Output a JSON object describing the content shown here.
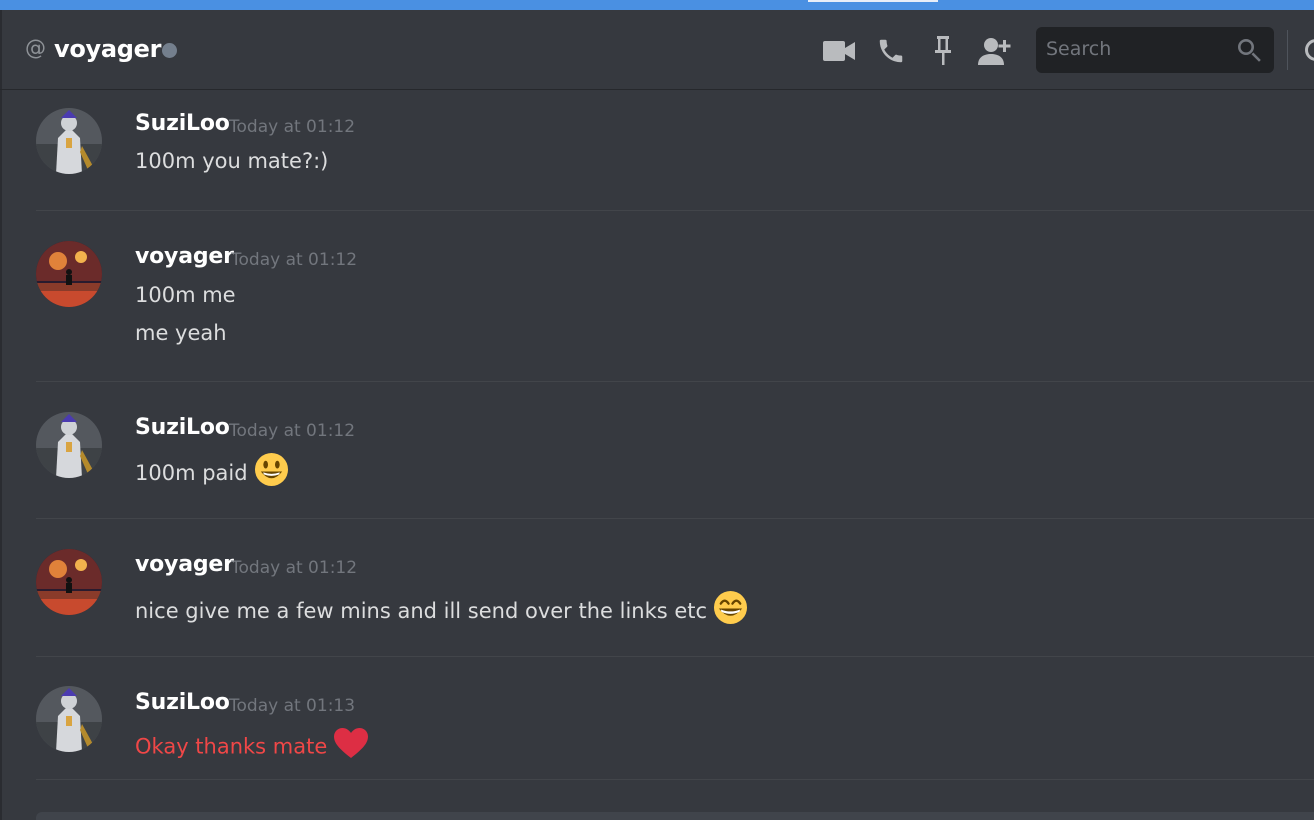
{
  "header": {
    "at_symbol": "@",
    "channel_name": "voyager",
    "status_color": "#747f8d",
    "icons": [
      "video-camera-icon",
      "phone-icon",
      "pin-icon",
      "add-friend-icon"
    ],
    "search_placeholder": "Search"
  },
  "colors": {
    "background": "#36393f",
    "accent_strip": "#4a90e2",
    "text": "#dcddde",
    "timestamp": "#72767d",
    "red_text": "#f04747"
  },
  "messages": [
    {
      "author": "SuziLoo",
      "timestamp": "Today at 01:12",
      "lines": [
        "100m you mate?:)"
      ]
    },
    {
      "author": "voyager",
      "timestamp": "Today at 01:12",
      "lines": [
        "100m me",
        "me yeah"
      ]
    },
    {
      "author": "SuziLoo",
      "timestamp": "Today at 01:12",
      "lines": [
        "100m paid"
      ],
      "emoji": "smiley-emoji"
    },
    {
      "author": "voyager",
      "timestamp": "Today at 01:12",
      "lines": [
        "nice give me a few mins and ill send over the links etc"
      ],
      "emoji": "grinning-emoji"
    },
    {
      "author": "SuziLoo",
      "timestamp": "Today at 01:13",
      "lines": [
        "Okay thanks mate"
      ],
      "emoji": "red-heart-emoji",
      "text_color": "red"
    }
  ]
}
